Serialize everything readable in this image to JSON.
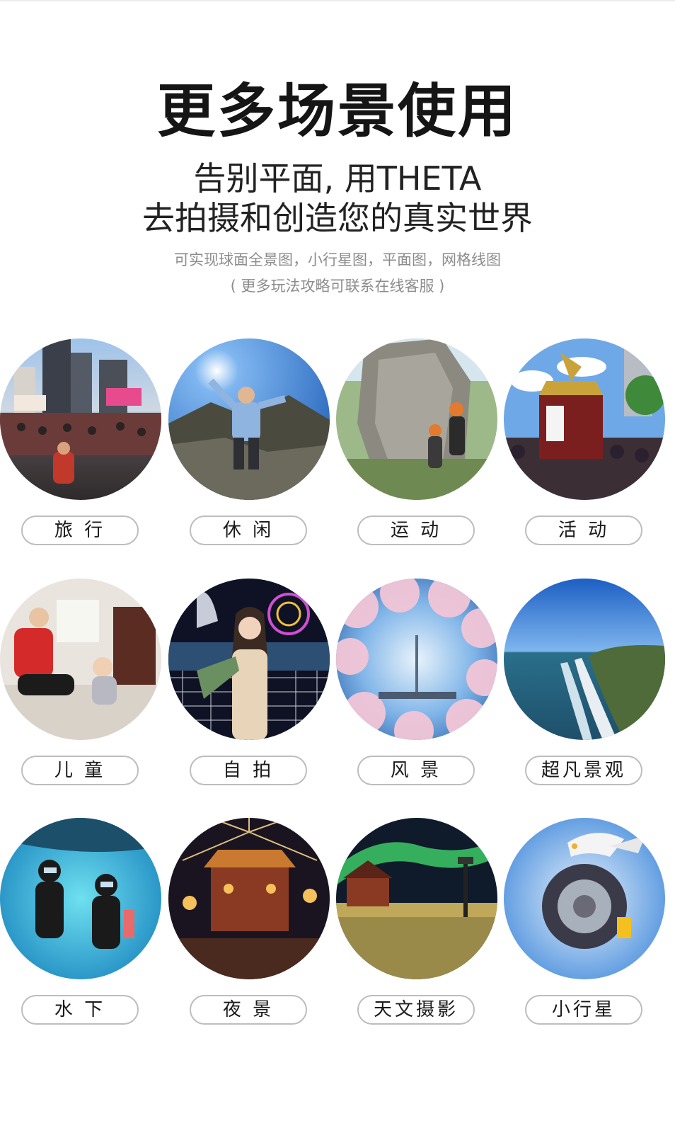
{
  "headline": "更多场景使用",
  "subheadline": {
    "line1": "告别平面, 用THETA",
    "line2": "去拍摄和创造您的真实世界"
  },
  "description": {
    "line1": "可实现球面全景图，小行星图，平面图，网格线图",
    "line2": "( 更多玩法攻略可联系在线客服 )"
  },
  "scenes": [
    {
      "label": "旅 行",
      "photo": "times-square-photo"
    },
    {
      "label": "休 闲",
      "photo": "hiker-summit-photo"
    },
    {
      "label": "运 动",
      "photo": "rock-climbing-photo"
    },
    {
      "label": "活 动",
      "photo": "festival-shrine-photo"
    },
    {
      "label": "儿 童",
      "photo": "mother-baby-photo"
    },
    {
      "label": "自 拍",
      "photo": "night-selfie-photo"
    },
    {
      "label": "风 景",
      "photo": "cherry-blossom-photo"
    },
    {
      "label": "超凡景观",
      "photo": "coastline-aerial-photo"
    },
    {
      "label": "水 下",
      "photo": "scuba-divers-photo"
    },
    {
      "label": "夜 景",
      "photo": "festival-fireworks-photo"
    },
    {
      "label": "天文摄影",
      "photo": "aurora-night-photo"
    },
    {
      "label": "小行星",
      "photo": "tiny-planet-seagull-photo"
    }
  ]
}
